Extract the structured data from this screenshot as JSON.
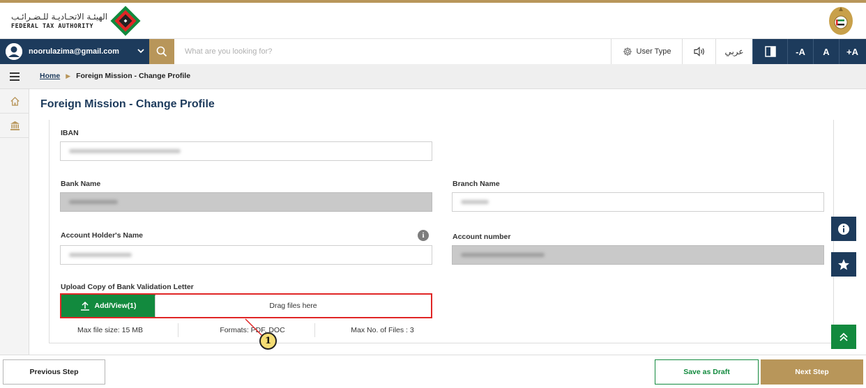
{
  "header": {
    "logo_arabic": "الهيئـة الاتحـاديـة للـضـرائـب",
    "logo_english": "FEDERAL TAX AUTHORITY",
    "logo_icon": "fta-logo-icon",
    "emblem_icon": "uae-emblem-icon"
  },
  "navbar": {
    "user_email": "noorulazima@gmail.com",
    "search_placeholder": "What are you looking for?",
    "user_type_label": "User Type",
    "arabic_label": "عربي",
    "font_decrease": "-A",
    "font_normal": "A",
    "font_increase": "+A"
  },
  "breadcrumb": {
    "home": "Home",
    "current": "Foreign Mission - Change Profile"
  },
  "page": {
    "title": "Foreign Mission - Change Profile"
  },
  "form": {
    "iban_label": "IBAN",
    "bank_name_label": "Bank Name",
    "branch_name_label": "Branch Name",
    "account_holder_label": "Account Holder's Name",
    "account_number_label": "Account number",
    "info_glyph": "i",
    "upload_label": "Upload Copy of Bank Validation Letter",
    "upload_button": "Add/View(1)",
    "drop_text": "Drag files here",
    "max_file_size": "Max file size: 15 MB",
    "formats": "Formats: PDF, DOC",
    "max_files": "Max No. of Files : 3"
  },
  "annotation": {
    "callout_number": "1"
  },
  "footer": {
    "previous": "Previous Step",
    "save_draft": "Save as Draft",
    "next": "Next Step"
  },
  "colors": {
    "navy": "#1d3b5c",
    "gold": "#b8965a",
    "green": "#128a3e",
    "highlight_red": "#e02626"
  }
}
